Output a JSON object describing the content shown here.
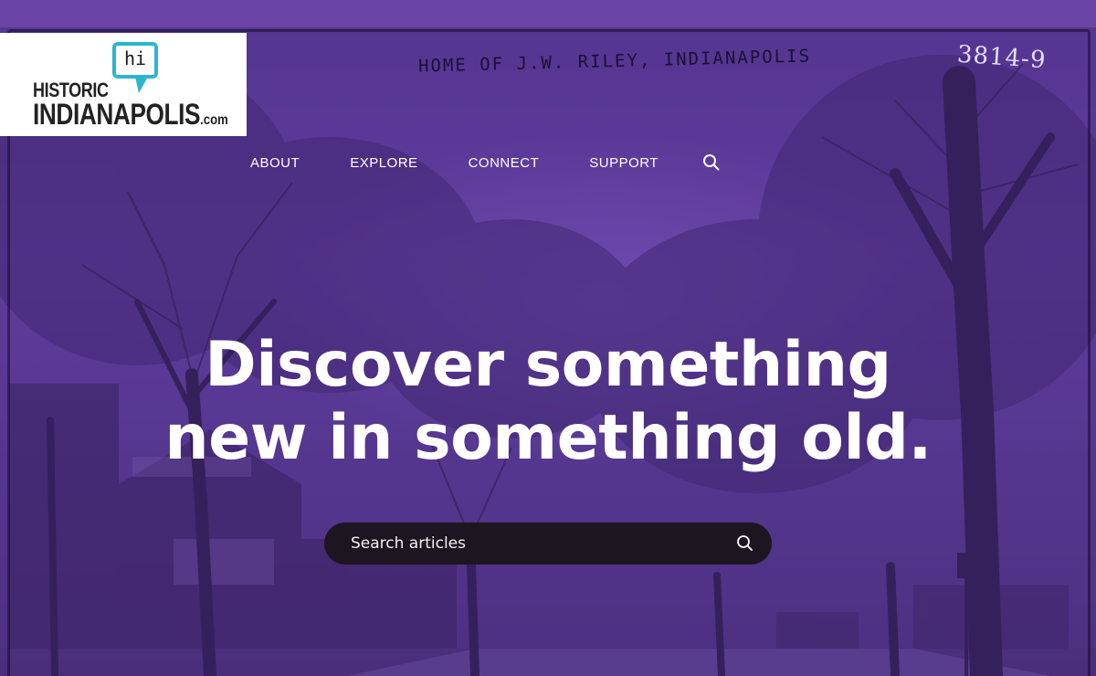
{
  "logo": {
    "bubble_text": "hi",
    "line1": "HISTORIC",
    "line2": "INDIANAPOLIS",
    "suffix": ".com",
    "accent_color": "#2bb6cc"
  },
  "photo": {
    "caption": "HOME OF J.W. RILEY, INDIANAPOLIS",
    "plate_number": "3814-9"
  },
  "nav": {
    "items": [
      {
        "label": "ABOUT"
      },
      {
        "label": "EXPLORE"
      },
      {
        "label": "CONNECT"
      },
      {
        "label": "SUPPORT"
      }
    ],
    "search_icon": "search-icon"
  },
  "hero": {
    "headline_line1": "Discover something",
    "headline_line2": "new in something old."
  },
  "search": {
    "placeholder": "Search articles",
    "icon": "search-icon"
  },
  "colors": {
    "brand_purple": "#6a45a6",
    "search_bar_bg": "#1d1520",
    "text_white": "#ffffff"
  }
}
